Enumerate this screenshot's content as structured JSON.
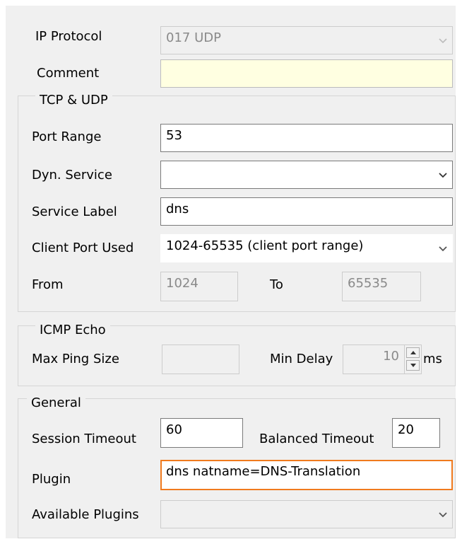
{
  "ip_protocol": {
    "label": "IP Protocol",
    "value": "017 UDP"
  },
  "comment": {
    "label": "Comment",
    "value": ""
  },
  "tcp_udp": {
    "title": "TCP & UDP",
    "port_range_label": "Port Range",
    "port_range_value": "53",
    "dyn_service_label": "Dyn. Service",
    "dyn_service_value": "",
    "service_label_label": "Service Label",
    "service_label_value": "dns",
    "client_port_label": "Client Port Used",
    "client_port_value": "1024-65535 (client port range)",
    "from_label": "From",
    "from_value": "1024",
    "to_label": "To",
    "to_value": "65535"
  },
  "icmp": {
    "title": "ICMP Echo",
    "max_ping_label": "Max Ping Size",
    "max_ping_value": "",
    "min_delay_label": "Min Delay",
    "min_delay_value": "10",
    "min_delay_unit": "ms"
  },
  "general": {
    "title": "General",
    "session_timeout_label": "Session Timeout",
    "session_timeout_value": "60",
    "balanced_timeout_label": "Balanced Timeout",
    "balanced_timeout_value": "20",
    "plugin_label": "Plugin",
    "plugin_value": "dns natname=DNS-Translation",
    "available_plugins_label": "Available Plugins",
    "available_plugins_value": ""
  },
  "icons": {
    "dropdown": "chevron-down-icon",
    "spin_up": "arrow-up-icon",
    "spin_down": "arrow-down-icon"
  },
  "colors": {
    "panel_bg": "#f0f0f0",
    "comment_bg": "#ffffe1",
    "focus_border": "#f07a1e"
  }
}
